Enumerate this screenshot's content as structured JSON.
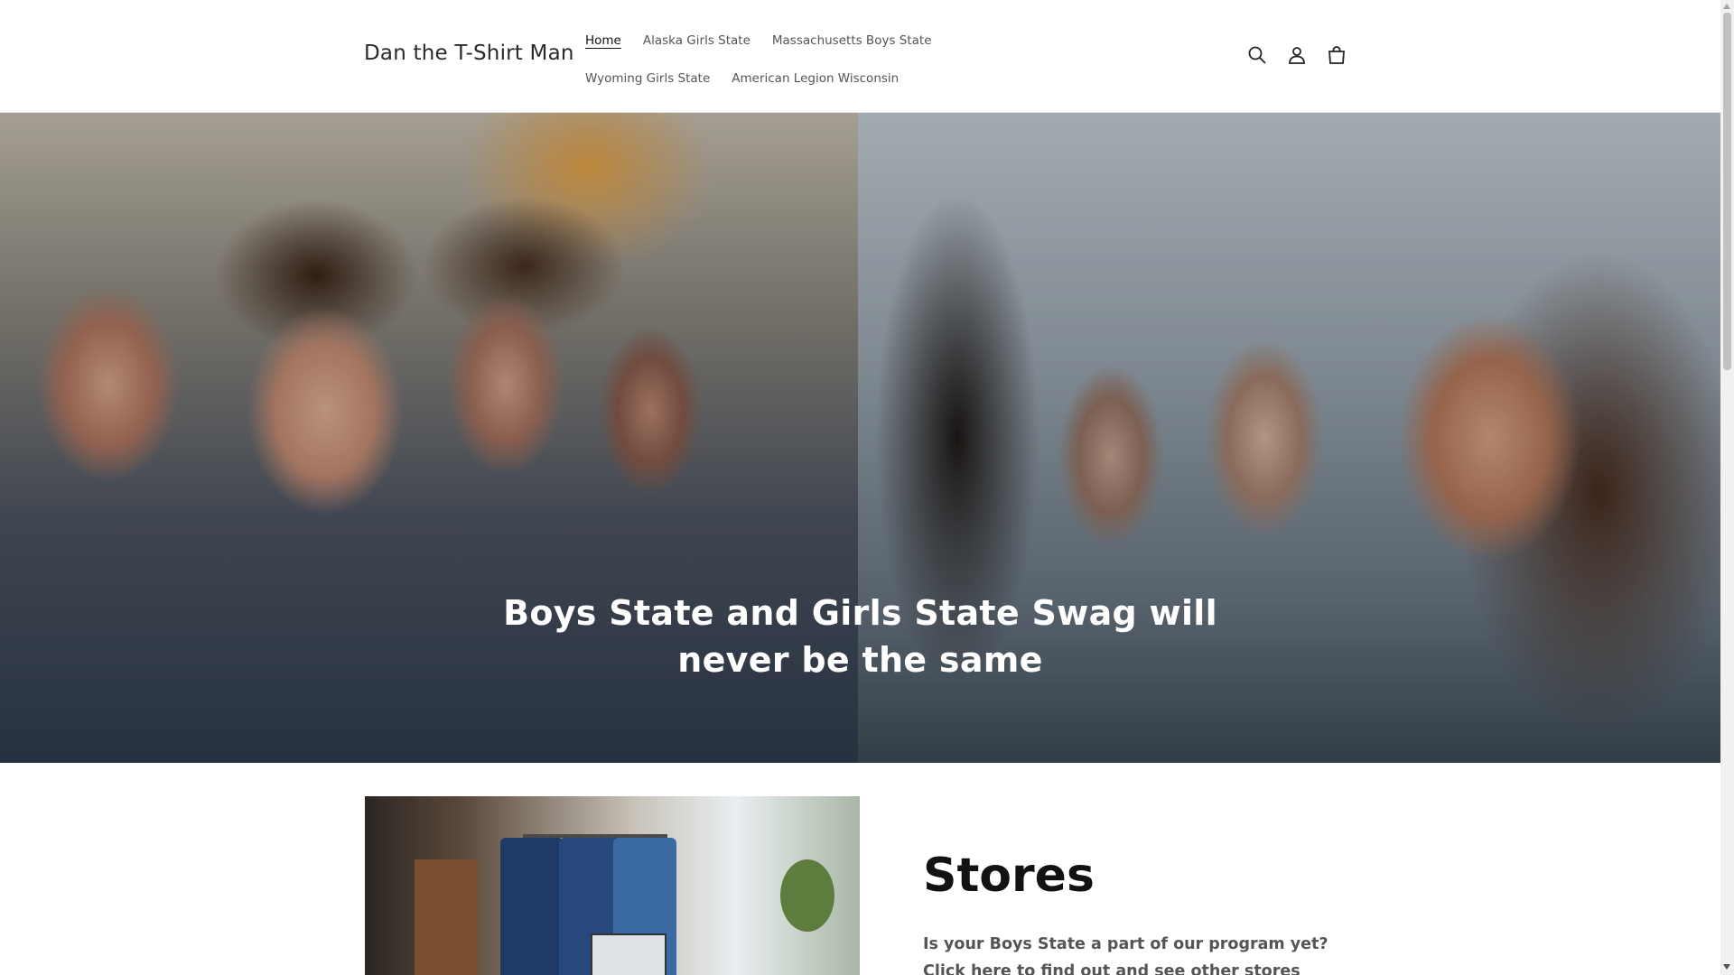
{
  "header": {
    "brand": "Dan the T-Shirt Man",
    "nav": [
      {
        "label": "Home",
        "active": true
      },
      {
        "label": "Alaska Girls State",
        "active": false
      },
      {
        "label": "Massachusetts Boys State",
        "active": false
      },
      {
        "label": "Wyoming Girls State",
        "active": false
      },
      {
        "label": "American Legion Wisconsin",
        "active": false
      }
    ],
    "icons": [
      "search-icon",
      "account-icon",
      "cart-icon"
    ]
  },
  "hero": {
    "title": "Boys State and Girls State Swag will never be the same"
  },
  "stores": {
    "title": "Stores",
    "text_line1": "Is your Boys State a part of our program yet?",
    "text_line2": "Click here to find out and see other stores"
  },
  "colors": {
    "text": "#121212",
    "nav_text": "#555555",
    "hero_text": "#ffffff"
  }
}
